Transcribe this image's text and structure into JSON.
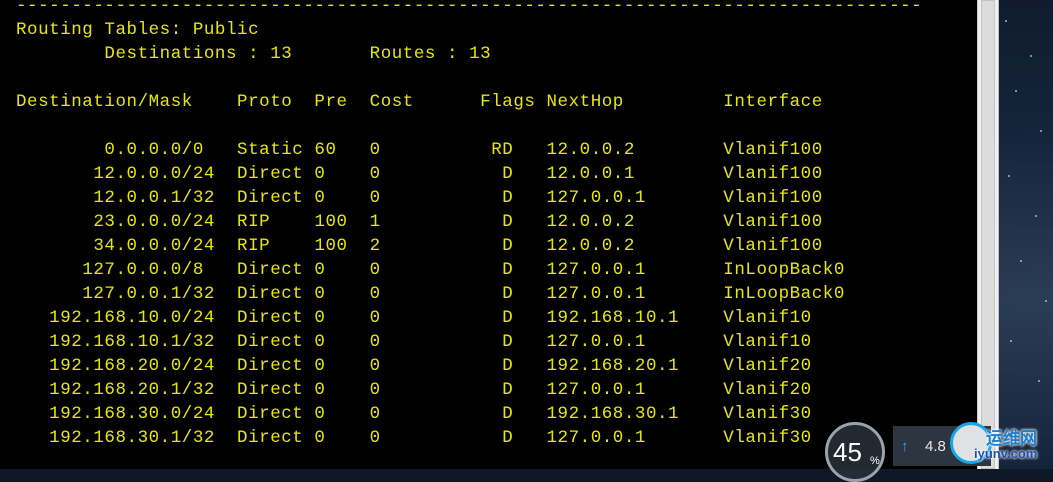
{
  "terminal": {
    "lines": [
      "----------------------------------------------------------------------------------",
      "Routing Tables: Public",
      "        Destinations : 13       Routes : 13",
      "",
      "Destination/Mask    Proto  Pre  Cost      Flags NextHop         Interface",
      "",
      "        0.0.0.0/0   Static 60   0          RD   12.0.0.2        Vlanif100",
      "       12.0.0.0/24  Direct 0    0           D   12.0.0.1        Vlanif100",
      "       12.0.0.1/32  Direct 0    0           D   127.0.0.1       Vlanif100",
      "       23.0.0.0/24  RIP    100  1           D   12.0.0.2        Vlanif100",
      "       34.0.0.0/24  RIP    100  2           D   12.0.0.2        Vlanif100",
      "      127.0.0.0/8   Direct 0    0           D   127.0.0.1       InLoopBack0",
      "      127.0.0.1/32  Direct 0    0           D   127.0.0.1       InLoopBack0",
      "   192.168.10.0/24  Direct 0    0           D   192.168.10.1    Vlanif10",
      "   192.168.10.1/32  Direct 0    0           D   127.0.0.1       Vlanif10",
      "   192.168.20.0/24  Direct 0    0           D   192.168.20.1    Vlanif20",
      "   192.168.20.1/32  Direct 0    0           D   127.0.0.1       Vlanif20",
      "   192.168.30.0/24  Direct 0    0           D   192.168.30.1    Vlanif30",
      "   192.168.30.1/32  Direct 0    0           D   127.0.0.1       Vlanif30"
    ],
    "text_color": "#e6e60a",
    "background": "#000000"
  },
  "speed_widget": {
    "gauge_value": "45",
    "gauge_unit": "%",
    "arrow_icon": "up-arrow-icon",
    "speed_text": "4.8"
  },
  "watermark": {
    "cn_text": "运维网",
    "url_text": "iyunv.com"
  }
}
